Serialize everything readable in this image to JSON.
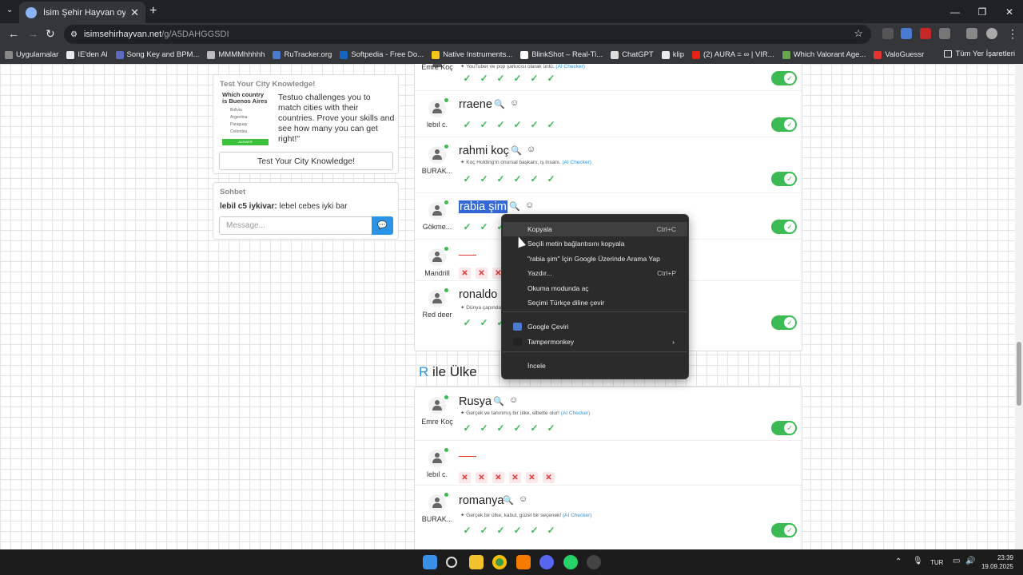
{
  "browser": {
    "tab_title": "İsim Şehir Hayvan oyununa katı",
    "tab_close": "✕",
    "new_tab": "+",
    "url_domain": "isimsehirhayvan.net",
    "url_path": "/g/A5DAHGGSDI",
    "window_controls": {
      "minimize": "—",
      "maximize": "❐",
      "close": "✕"
    }
  },
  "bookmarks": {
    "items": [
      {
        "label": "Uygulamalar",
        "color": "#888888"
      },
      {
        "label": "IE'den Al",
        "color": "#e8eaed"
      },
      {
        "label": "Song Key and BPM...",
        "color": "#5c6bc0"
      },
      {
        "label": "MMMMhhhhh",
        "color": "#bbbbbb"
      },
      {
        "label": "RuTracker.org",
        "color": "#4a7bd0"
      },
      {
        "label": "Softpedia - Free Do...",
        "color": "#1565c0"
      },
      {
        "label": "Native Instruments...",
        "color": "#f5c518"
      },
      {
        "label": "BlinkShot – Real-Ti...",
        "color": "#ffffff"
      },
      {
        "label": "ChatGPT",
        "color": "#dddddd"
      },
      {
        "label": "klip",
        "color": "#e8eaed"
      },
      {
        "label": "(2) AURA = ∞ | VIR...",
        "color": "#e62117"
      },
      {
        "label": "Which Valorant Age...",
        "color": "#6aa84f"
      },
      {
        "label": "ValoGuessr",
        "color": "#e23333"
      }
    ],
    "all_bookmarks": "Tüm Yer İşaretleri"
  },
  "sidebar": {
    "city_card": {
      "title": "Test Your City Knowledge!",
      "preview_question": "Which country is Buenos Aires",
      "preview_options": [
        "Bolivia",
        "Argentina",
        "Paraguay",
        "Colombia"
      ],
      "preview_button": "ANSWER",
      "description": "Testuo challenges you to match cities with their countries. Prove your skills and see how many you can get right!\"",
      "button": "Test Your City Knowledge!"
    },
    "chat": {
      "title": "Sohbet",
      "message_user": "lebil c5 iykivar:",
      "message_text": "lebel cebes iyki bar",
      "input_placeholder": "Message...",
      "send_icon": "💬"
    }
  },
  "city_rows": [
    {
      "user": "Emre Koç",
      "word": "",
      "note": "YouTuber ve pop şarkıcısı olarak ünlü.",
      "ai": "(AI Checker)",
      "result": "ok",
      "toggle": true
    },
    {
      "user": "lebıl c.",
      "word": "rraene",
      "note": "",
      "ai": "",
      "result": "ok",
      "toggle": true
    },
    {
      "user": "BURAK...",
      "word": "rahmi koç",
      "note": "Koç Holding'in onursal başkanı, iş insanı.",
      "ai": "(AI Checker)",
      "result": "ok",
      "toggle": true
    },
    {
      "user": "Gökme...",
      "word": "rabia şim",
      "note": "",
      "ai": "",
      "result": "ok",
      "toggle": true,
      "selected": true
    },
    {
      "user": "Mandrill",
      "word": "",
      "note": "",
      "ai": "",
      "result": "no",
      "toggle": false,
      "empty": true
    },
    {
      "user": "Red deer",
      "word": "ronaldo",
      "note": "Dünya çapında",
      "ai": "",
      "result": "ok",
      "toggle": true
    }
  ],
  "country_section": {
    "letter": "R",
    "title": "ile Ülke",
    "rows": [
      {
        "user": "Emre Koç",
        "word": "Rusya",
        "note": "Gerçek ve tanınmış bir ülke, elbette olur!",
        "ai": "(AI Checker)",
        "result": "ok",
        "toggle": true
      },
      {
        "user": "lebıl c.",
        "word": "",
        "note": "",
        "ai": "",
        "result": "no",
        "toggle": false,
        "empty": true
      },
      {
        "user": "BURAK...",
        "word": "romanya",
        "note": "Gerçek bir ülke; kabul, güzel bir seçenek!",
        "ai": "(AI Checker)",
        "result": "ok",
        "toggle": true
      }
    ]
  },
  "marks": {
    "ok": "✓",
    "no": "✕",
    "count": 6
  },
  "context_menu": {
    "items": [
      {
        "label": "Kopyala",
        "shortcut": "Ctrl+C"
      },
      {
        "label": "Seçili metin bağlantısını kopyala",
        "shortcut": ""
      },
      {
        "label": "\"rabia şim\" İçin Google Üzerinde Arama Yap",
        "shortcut": ""
      },
      {
        "label": "Yazdır...",
        "shortcut": "Ctrl+P"
      },
      {
        "label": "Okuma modunda aç",
        "shortcut": ""
      },
      {
        "label": "Seçimi Türkçe diline çevir",
        "shortcut": ""
      },
      {
        "label": "Google Çeviri",
        "shortcut": ""
      },
      {
        "label": "Tampermonkey",
        "shortcut": "›"
      },
      {
        "label": "İncele",
        "shortcut": ""
      }
    ]
  },
  "taskbar": {
    "language": "TUR",
    "time": "23:39",
    "date": "19.09.2025"
  }
}
